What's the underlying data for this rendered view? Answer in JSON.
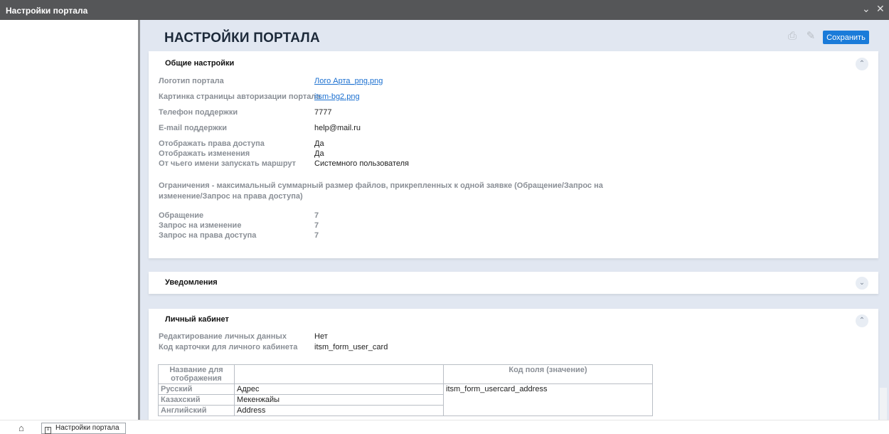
{
  "window": {
    "title": "Настройки портала"
  },
  "page": {
    "title": "НАСТРОЙКИ ПОРТАЛА",
    "save_label": "Сохранить"
  },
  "general": {
    "title": "Общие настройки",
    "logo_label": "Логотип портала",
    "logo_value": "Лого Арта_png.png",
    "auth_image_label": "Картинка страницы авторизации портала",
    "auth_image_value": "itsm-bg2.png",
    "phone_label": "Телефон поддержки",
    "phone_value": "7777",
    "email_label": "E-mail поддержки",
    "email_value": "help@mail.ru",
    "show_access_label": "Отображать права доступа",
    "show_access_value": "Да",
    "show_changes_label": "Отображать изменения",
    "show_changes_value": "Да",
    "run_as_label": "От чьего имени запускать маршрут",
    "run_as_value": "Системного пользователя",
    "limits_note": "Ограничения - максимальный суммарный размер файлов, прикрепленных к одной заявке (Обращение/Запрос на изменение/Запрос на права доступа)",
    "limit_request_label": "Обращение",
    "limit_request_value": "7",
    "limit_change_label": "Запрос на изменение",
    "limit_change_value": "7",
    "limit_access_label": "Запрос на права доступа",
    "limit_access_value": "7"
  },
  "notifications": {
    "title": "Уведомления"
  },
  "cabinet": {
    "title": "Личный кабинет",
    "edit_label": "Редактирование личных данных",
    "edit_value": "Нет",
    "card_code_label": "Код карточки для личного кабинета",
    "card_code_value": "itsm_form_user_card",
    "table": {
      "col_name": "Название для отображения",
      "col_empty": "",
      "col_code": "Код поля (значение)",
      "code_value": "itsm_form_usercard_address",
      "rows": [
        {
          "lang": "Русский",
          "value": "Адрес"
        },
        {
          "lang": "Казахский",
          "value": "Мекенжайы"
        },
        {
          "lang": "Английский",
          "value": "Address"
        }
      ]
    }
  },
  "taskbar": {
    "tab_label": "Настройки портала"
  },
  "colors": {
    "accent": "#1a7bd9",
    "titlebar": "#555658",
    "content_bg": "#e1e7f1"
  }
}
